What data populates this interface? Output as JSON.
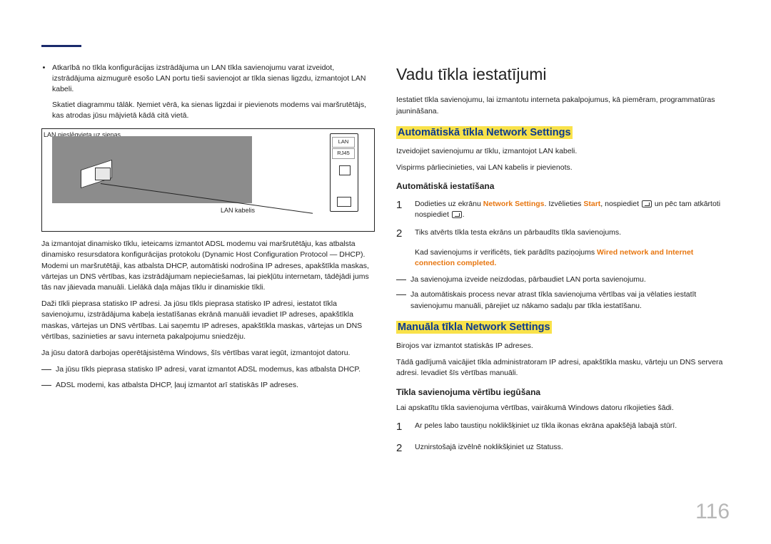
{
  "left": {
    "bullet1": "Atkarībā no tīkla konfigurācijas izstrādājuma un LAN tīkla savienojumu varat izveidot, izstrādājuma aizmugurē esošo LAN portu tieši savienojot ar tīkla sienas ligzdu, izmantojot LAN kabeli.",
    "bullet1_sub": "Skatiet diagrammu tālāk. Ņemiet vērā, ka sienas ligzdai ir pievienots modems vai maršrutētājs, kas atrodas jūsu mājvietā kādā citā vietā.",
    "diagram": {
      "wall_label": "LAN pieslēgvieta uz sienas",
      "cable_label": "LAN kabelis",
      "lan": "LAN",
      "port": "RJ45"
    },
    "p1": "Ja izmantojat dinamisko tīklu, ieteicams izmantot ADSL modemu vai maršrutētāju, kas atbalsta dinamisko resursdatora konfigurācijas protokolu (Dynamic Host Configuration Protocol — DHCP). Modemi un maršrutētāji, kas atbalsta DHCP, automātiski nodrošina IP adreses, apakštīkla maskas, vārtejas un DNS vērtības, kas izstrādājumam nepieciešamas, lai piekļūtu internetam, tādējādi jums tās nav jāievada manuāli. Lielākā daļa mājas tīklu ir dinamiskie tīkli.",
    "p2": "Daži tīkli pieprasa statisko IP adresi. Ja jūsu tīkls pieprasa statisko IP adresi, iestatot tīkla savienojumu, izstrādājuma kabeļa iestatīšanas ekrānā manuāli ievadiet IP adreses, apakštīkla maskas, vārtejas un DNS vērtības. Lai saņemtu IP adreses, apakštīkla maskas, vārtejas un DNS vērtības, sazinieties ar savu interneta pakalpojumu sniedzēju.",
    "p3": "Ja jūsu datorā darbojas operētājsistēma Windows, šīs vērtības varat iegūt, izmantojot datoru.",
    "dash1": "Ja jūsu tīkls pieprasa statisko IP adresi, varat izmantot ADSL modemus, kas atbalsta DHCP.",
    "dash2": "ADSL modemi, kas atbalsta DHCP, ļauj izmantot arī statiskās IP adreses."
  },
  "right": {
    "h1": "Vadu tīkla iestatījumi",
    "intro": "Iestatiet tīkla savienojumu, lai izmantotu interneta pakalpojumus, kā piemēram, programmatūras jaunināšana.",
    "auto_h2": "Automātiskā tīkla Network Settings",
    "auto_p1": "Izveidojiet savienojumu ar tīklu, izmantojot LAN kabeli.",
    "auto_p2": "Vispirms pārliecinieties, vai LAN kabelis ir pievienots.",
    "auto_h3": "Automātiskā iestatīšana",
    "step1a": "Dodieties uz ekrānu ",
    "step1_ns": "Network Settings",
    "step1b": ". Izvēlieties ",
    "step1_start": "Start",
    "step1c": ", nospiediet ",
    "step1d": " un pēc tam atkārtoti nospiediet ",
    "step1e": ".",
    "step2": "Tiks atvērts tīkla testa ekrāns un pārbaudīts tīkla savienojums.",
    "step2_sub_a": "Kad savienojums ir verificēts, tiek parādīts paziņojums ",
    "step2_sub_orange": "Wired network and Internet connection completed.",
    "dash3": "Ja savienojuma izveide neizdodas, pārbaudiet LAN porta savienojumu.",
    "dash4": "Ja automātiskais process nevar atrast tīkla savienojuma vērtības vai ja vēlaties iestatīt savienojumu manuāli, pārejiet uz nākamo sadaļu par tīkla iestatīšanu.",
    "man_h2": "Manuāla tīkla Network Settings",
    "man_p1": "Birojos var izmantot statiskās IP adreses.",
    "man_p2": "Tādā gadījumā vaicājiet tīkla administratoram IP adresi, apakštīkla masku, vārteju un DNS servera adresi. Ievadiet šīs vērtības manuāli.",
    "man_h3": "Tīkla savienojuma vērtību iegūšana",
    "man_intro": "Lai apskatītu tīkla savienojuma vērtības, vairākumā Windows datoru rīkojieties šādi.",
    "mstep1": "Ar peles labo taustiņu noklikšķiniet uz tīkla ikonas ekrāna apakšējā labajā stūrī.",
    "mstep2": "Uznirstošajā izvēlnē noklikšķiniet uz Statuss."
  },
  "page_number": "116"
}
